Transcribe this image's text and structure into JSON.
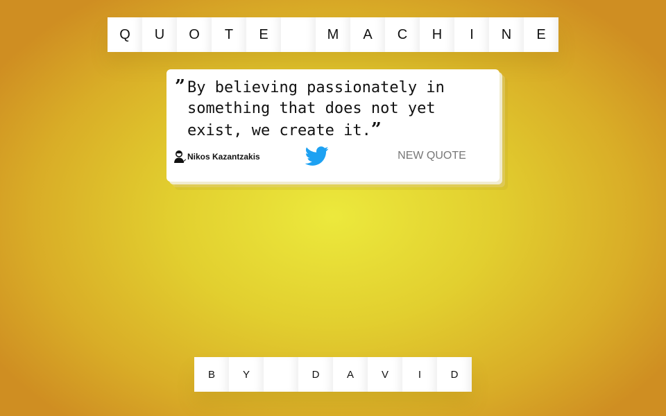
{
  "header": {
    "title_letters": [
      "Q",
      "U",
      "O",
      "T",
      "E",
      "",
      "M",
      "A",
      "C",
      "H",
      "I",
      "N",
      "E"
    ]
  },
  "quote": {
    "open_mark": "”",
    "text": "By believing passionately in something that does not yet exist, we create it.",
    "close_mark": "”",
    "author": "Nikos Kazantzakis",
    "author_icon": "person-icon",
    "tweet_icon": "twitter-bird-icon",
    "new_quote_label": "NEW QUOTE"
  },
  "footer": {
    "credit_letters": [
      "B",
      "Y",
      "",
      "D",
      "A",
      "V",
      "I",
      "D"
    ]
  },
  "colors": {
    "background_center": "#ece93c",
    "background_edge": "#cf8e22",
    "twitter_blue": "#1da1f2",
    "card": "#ffffff"
  }
}
